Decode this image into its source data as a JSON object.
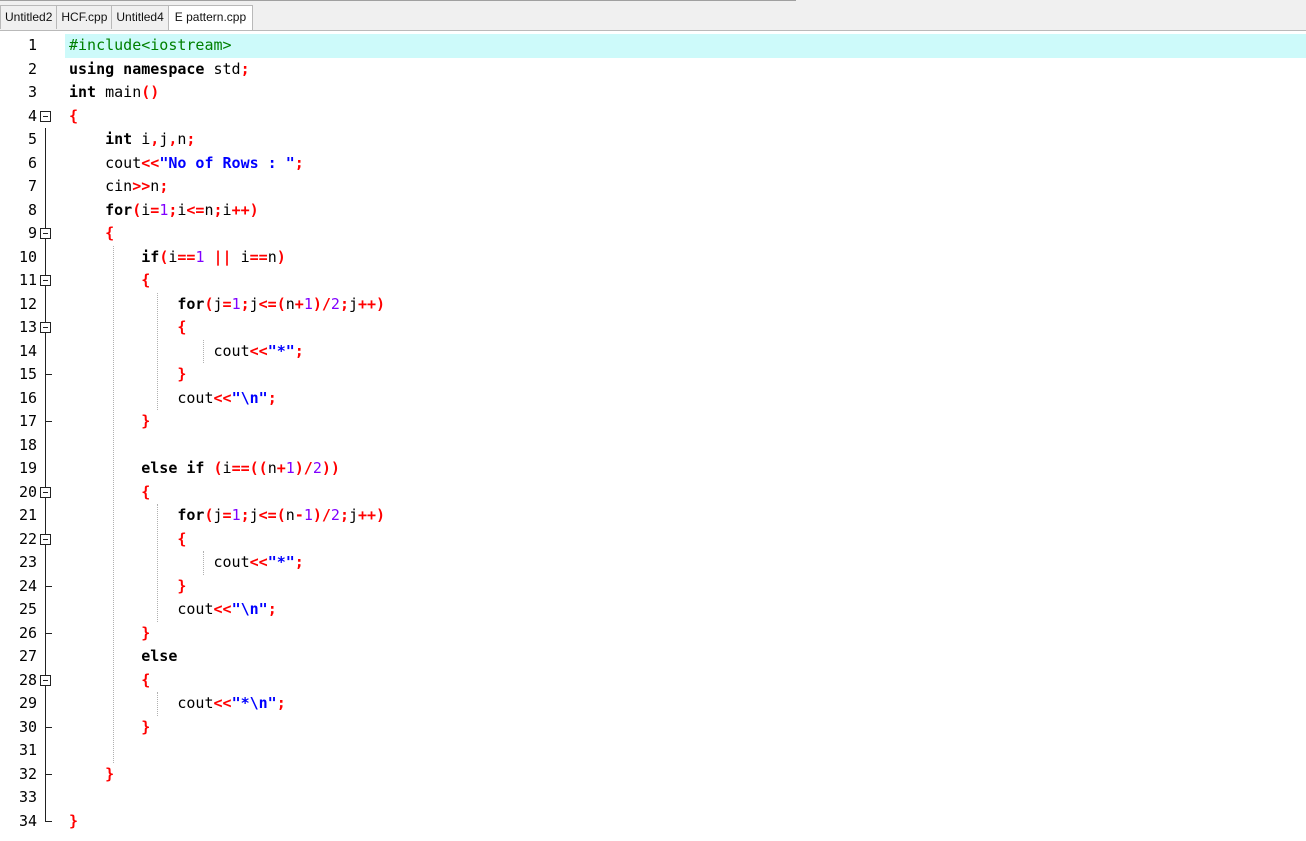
{
  "tabs": [
    {
      "label": "Untitled2",
      "active": false
    },
    {
      "label": "HCF.cpp",
      "active": false
    },
    {
      "label": "Untitled4",
      "active": false
    },
    {
      "label": "E pattern.cpp",
      "active": true
    }
  ],
  "editor": {
    "current_line": 1,
    "lines": [
      {
        "n": "1",
        "fold": "",
        "tokens": [
          [
            "pp",
            "#include<iostream>"
          ]
        ]
      },
      {
        "n": "2",
        "fold": "",
        "tokens": [
          [
            "kw",
            "using namespace"
          ],
          [
            "",
            " std"
          ],
          [
            "op",
            ";"
          ]
        ]
      },
      {
        "n": "3",
        "fold": "",
        "tokens": [
          [
            "kw",
            "int"
          ],
          [
            "",
            " main"
          ],
          [
            "op",
            "()"
          ]
        ]
      },
      {
        "n": "4",
        "fold": "open",
        "tokens": [
          [
            "op",
            "{"
          ]
        ]
      },
      {
        "n": "5",
        "fold": "line",
        "tokens": [
          [
            "",
            "    "
          ],
          [
            "kw",
            "int"
          ],
          [
            "",
            " i"
          ],
          [
            "op",
            ","
          ],
          [
            "",
            "j"
          ],
          [
            "op",
            ","
          ],
          [
            "",
            "n"
          ],
          [
            "op",
            ";"
          ]
        ]
      },
      {
        "n": "6",
        "fold": "line",
        "tokens": [
          [
            "",
            "    cout"
          ],
          [
            "op",
            "<<"
          ],
          [
            "str",
            "\"No of Rows : \""
          ],
          [
            "op",
            ";"
          ]
        ]
      },
      {
        "n": "7",
        "fold": "line",
        "tokens": [
          [
            "",
            "    cin"
          ],
          [
            "op",
            ">>"
          ],
          [
            "",
            "n"
          ],
          [
            "op",
            ";"
          ]
        ]
      },
      {
        "n": "8",
        "fold": "line",
        "tokens": [
          [
            "",
            "    "
          ],
          [
            "kw",
            "for"
          ],
          [
            "op",
            "("
          ],
          [
            "",
            "i"
          ],
          [
            "op",
            "="
          ],
          [
            "num",
            "1"
          ],
          [
            "op",
            ";"
          ],
          [
            "",
            "i"
          ],
          [
            "op",
            "<="
          ],
          [
            "",
            "n"
          ],
          [
            "op",
            ";"
          ],
          [
            "",
            "i"
          ],
          [
            "op",
            "++)"
          ]
        ]
      },
      {
        "n": "9",
        "fold": "open",
        "tokens": [
          [
            "",
            "    "
          ],
          [
            "op",
            "{"
          ]
        ]
      },
      {
        "n": "10",
        "fold": "line",
        "tokens": [
          [
            "",
            "        "
          ],
          [
            "kw",
            "if"
          ],
          [
            "op",
            "("
          ],
          [
            "",
            "i"
          ],
          [
            "op",
            "=="
          ],
          [
            "num",
            "1"
          ],
          [
            "",
            " "
          ],
          [
            "op",
            "||"
          ],
          [
            "",
            " i"
          ],
          [
            "op",
            "=="
          ],
          [
            "",
            "n"
          ],
          [
            "op",
            ")"
          ]
        ]
      },
      {
        "n": "11",
        "fold": "open",
        "tokens": [
          [
            "",
            "        "
          ],
          [
            "op",
            "{"
          ]
        ]
      },
      {
        "n": "12",
        "fold": "line",
        "tokens": [
          [
            "",
            "            "
          ],
          [
            "kw",
            "for"
          ],
          [
            "op",
            "("
          ],
          [
            "",
            "j"
          ],
          [
            "op",
            "="
          ],
          [
            "num",
            "1"
          ],
          [
            "op",
            ";"
          ],
          [
            "",
            "j"
          ],
          [
            "op",
            "<=("
          ],
          [
            "",
            "n"
          ],
          [
            "op",
            "+"
          ],
          [
            "num",
            "1"
          ],
          [
            "op",
            ")/"
          ],
          [
            "num",
            "2"
          ],
          [
            "op",
            ";"
          ],
          [
            "",
            "j"
          ],
          [
            "op",
            "++)"
          ]
        ]
      },
      {
        "n": "13",
        "fold": "open",
        "tokens": [
          [
            "",
            "            "
          ],
          [
            "op",
            "{"
          ]
        ]
      },
      {
        "n": "14",
        "fold": "line",
        "tokens": [
          [
            "",
            "                cout"
          ],
          [
            "op",
            "<<"
          ],
          [
            "str",
            "\"*\""
          ],
          [
            "op",
            ";"
          ]
        ]
      },
      {
        "n": "15",
        "fold": "end",
        "tokens": [
          [
            "",
            "            "
          ],
          [
            "op",
            "}"
          ]
        ]
      },
      {
        "n": "16",
        "fold": "line",
        "tokens": [
          [
            "",
            "            cout"
          ],
          [
            "op",
            "<<"
          ],
          [
            "str",
            "\"\\n\""
          ],
          [
            "op",
            ";"
          ]
        ]
      },
      {
        "n": "17",
        "fold": "end",
        "tokens": [
          [
            "",
            "        "
          ],
          [
            "op",
            "}"
          ]
        ]
      },
      {
        "n": "18",
        "fold": "line",
        "tokens": []
      },
      {
        "n": "19",
        "fold": "line",
        "tokens": [
          [
            "",
            "        "
          ],
          [
            "kw",
            "else if"
          ],
          [
            "",
            " "
          ],
          [
            "op",
            "("
          ],
          [
            "",
            "i"
          ],
          [
            "op",
            "==(("
          ],
          [
            "",
            "n"
          ],
          [
            "op",
            "+"
          ],
          [
            "num",
            "1"
          ],
          [
            "op",
            ")/"
          ],
          [
            "num",
            "2"
          ],
          [
            "op",
            "))"
          ]
        ]
      },
      {
        "n": "20",
        "fold": "open",
        "tokens": [
          [
            "",
            "        "
          ],
          [
            "op",
            "{"
          ]
        ]
      },
      {
        "n": "21",
        "fold": "line",
        "tokens": [
          [
            "",
            "            "
          ],
          [
            "kw",
            "for"
          ],
          [
            "op",
            "("
          ],
          [
            "",
            "j"
          ],
          [
            "op",
            "="
          ],
          [
            "num",
            "1"
          ],
          [
            "op",
            ";"
          ],
          [
            "",
            "j"
          ],
          [
            "op",
            "<=("
          ],
          [
            "",
            "n"
          ],
          [
            "op",
            "-"
          ],
          [
            "num",
            "1"
          ],
          [
            "op",
            ")/"
          ],
          [
            "num",
            "2"
          ],
          [
            "op",
            ";"
          ],
          [
            "",
            "j"
          ],
          [
            "op",
            "++)"
          ]
        ]
      },
      {
        "n": "22",
        "fold": "open",
        "tokens": [
          [
            "",
            "            "
          ],
          [
            "op",
            "{"
          ]
        ]
      },
      {
        "n": "23",
        "fold": "line",
        "tokens": [
          [
            "",
            "                cout"
          ],
          [
            "op",
            "<<"
          ],
          [
            "str",
            "\"*\""
          ],
          [
            "op",
            ";"
          ]
        ]
      },
      {
        "n": "24",
        "fold": "end",
        "tokens": [
          [
            "",
            "            "
          ],
          [
            "op",
            "}"
          ]
        ]
      },
      {
        "n": "25",
        "fold": "line",
        "tokens": [
          [
            "",
            "            cout"
          ],
          [
            "op",
            "<<"
          ],
          [
            "str",
            "\"\\n\""
          ],
          [
            "op",
            ";"
          ]
        ]
      },
      {
        "n": "26",
        "fold": "end",
        "tokens": [
          [
            "",
            "        "
          ],
          [
            "op",
            "}"
          ]
        ]
      },
      {
        "n": "27",
        "fold": "line",
        "tokens": [
          [
            "",
            "        "
          ],
          [
            "kw",
            "else"
          ]
        ]
      },
      {
        "n": "28",
        "fold": "open",
        "tokens": [
          [
            "",
            "        "
          ],
          [
            "op",
            "{"
          ]
        ]
      },
      {
        "n": "29",
        "fold": "line",
        "tokens": [
          [
            "",
            "            cout"
          ],
          [
            "op",
            "<<"
          ],
          [
            "str",
            "\"*\\n\""
          ],
          [
            "op",
            ";"
          ]
        ]
      },
      {
        "n": "30",
        "fold": "end",
        "tokens": [
          [
            "",
            "        "
          ],
          [
            "op",
            "}"
          ]
        ]
      },
      {
        "n": "31",
        "fold": "line",
        "tokens": []
      },
      {
        "n": "32",
        "fold": "end",
        "tokens": [
          [
            "",
            "    "
          ],
          [
            "op",
            "}"
          ]
        ]
      },
      {
        "n": "33",
        "fold": "line",
        "tokens": []
      },
      {
        "n": "34",
        "fold": "last",
        "tokens": [
          [
            "op",
            "}"
          ]
        ]
      }
    ]
  },
  "colors": {
    "current_line": "#cdfafa",
    "keyword": "#000000",
    "preprocessor": "#008000",
    "string": "#0000ff",
    "operator": "#ff0000",
    "number": "#8000ff"
  }
}
